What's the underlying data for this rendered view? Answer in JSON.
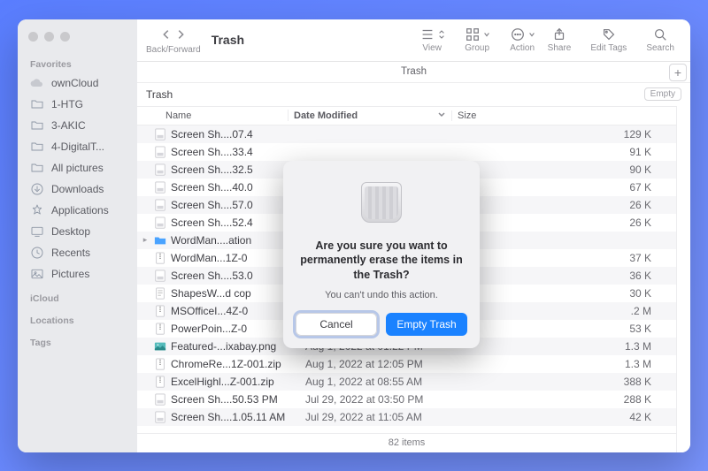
{
  "window": {
    "title": "Trash"
  },
  "toolbar": {
    "back_forward_label": "Back/Forward",
    "view_label": "View",
    "group_label": "Group",
    "action_label": "Action",
    "share_label": "Share",
    "edit_tags_label": "Edit Tags",
    "search_label": "Search"
  },
  "pathbar": {
    "location": "Trash",
    "plus": "+"
  },
  "location_header": {
    "name": "Trash",
    "empty_button": "Empty"
  },
  "columns": {
    "name": "Name",
    "date": "Date Modified",
    "size": "Size"
  },
  "sidebar": {
    "favorites_label": "Favorites",
    "icloud_label": "iCloud",
    "locations_label": "Locations",
    "tags_label": "Tags",
    "items": [
      {
        "label": "ownCloud",
        "icon": "cloud"
      },
      {
        "label": "1-HTG",
        "icon": "folder"
      },
      {
        "label": "3-AKIC",
        "icon": "folder"
      },
      {
        "label": "4-DigitalT...",
        "icon": "folder"
      },
      {
        "label": "All pictures",
        "icon": "folder"
      },
      {
        "label": "Downloads",
        "icon": "download"
      },
      {
        "label": "Applications",
        "icon": "apps"
      },
      {
        "label": "Desktop",
        "icon": "desktop"
      },
      {
        "label": "Recents",
        "icon": "recents"
      },
      {
        "label": "Pictures",
        "icon": "pictures"
      }
    ]
  },
  "rows": [
    {
      "icon": "png",
      "name": "Screen Sh....07.4",
      "date": "",
      "size": "129 K"
    },
    {
      "icon": "png",
      "name": "Screen Sh....33.4",
      "date": "",
      "size": "91 K"
    },
    {
      "icon": "png",
      "name": "Screen Sh....32.5",
      "date": "",
      "size": "90 K"
    },
    {
      "icon": "png",
      "name": "Screen Sh....40.0",
      "date": "",
      "size": "67 K"
    },
    {
      "icon": "png",
      "name": "Screen Sh....57.0",
      "date": "",
      "size": "26 K"
    },
    {
      "icon": "png",
      "name": "Screen Sh....52.4",
      "date": "",
      "size": "26 K"
    },
    {
      "icon": "folder",
      "name": "WordMan....ation",
      "date": "",
      "size": "",
      "has_children": true
    },
    {
      "icon": "zip",
      "name": "WordMan...1Z-0",
      "date": "",
      "size": "37 K"
    },
    {
      "icon": "png",
      "name": "Screen Sh....53.0",
      "date": "",
      "size": "36 K"
    },
    {
      "icon": "doc",
      "name": "ShapesW...d cop",
      "date": "",
      "size": "30 K"
    },
    {
      "icon": "zip",
      "name": "MSOfficeI...4Z-0",
      "date": "",
      "size": ".2 M"
    },
    {
      "icon": "zip",
      "name": "PowerPoin...Z-0",
      "date": "",
      "size": "53 K"
    },
    {
      "icon": "img",
      "name": "Featured-...ixabay.png",
      "date": "Aug 1, 2022 at 01:22 PM",
      "size": "1.3 M"
    },
    {
      "icon": "zip",
      "name": "ChromeRe...1Z-001.zip",
      "date": "Aug 1, 2022 at 12:05 PM",
      "size": "1.3 M"
    },
    {
      "icon": "zip",
      "name": "ExcelHighl...Z-001.zip",
      "date": "Aug 1, 2022 at 08:55 AM",
      "size": "388 K"
    },
    {
      "icon": "png",
      "name": "Screen Sh....50.53 PM",
      "date": "Jul 29, 2022 at 03:50 PM",
      "size": "288 K"
    },
    {
      "icon": "png",
      "name": "Screen Sh....1.05.11 AM",
      "date": "Jul 29, 2022 at 11:05 AM",
      "size": "42 K"
    }
  ],
  "status": {
    "text": "82 items"
  },
  "dialog": {
    "heading": "Are you sure you want to permanently erase the items in the Trash?",
    "subtext": "You can't undo this action.",
    "cancel": "Cancel",
    "confirm": "Empty Trash"
  }
}
